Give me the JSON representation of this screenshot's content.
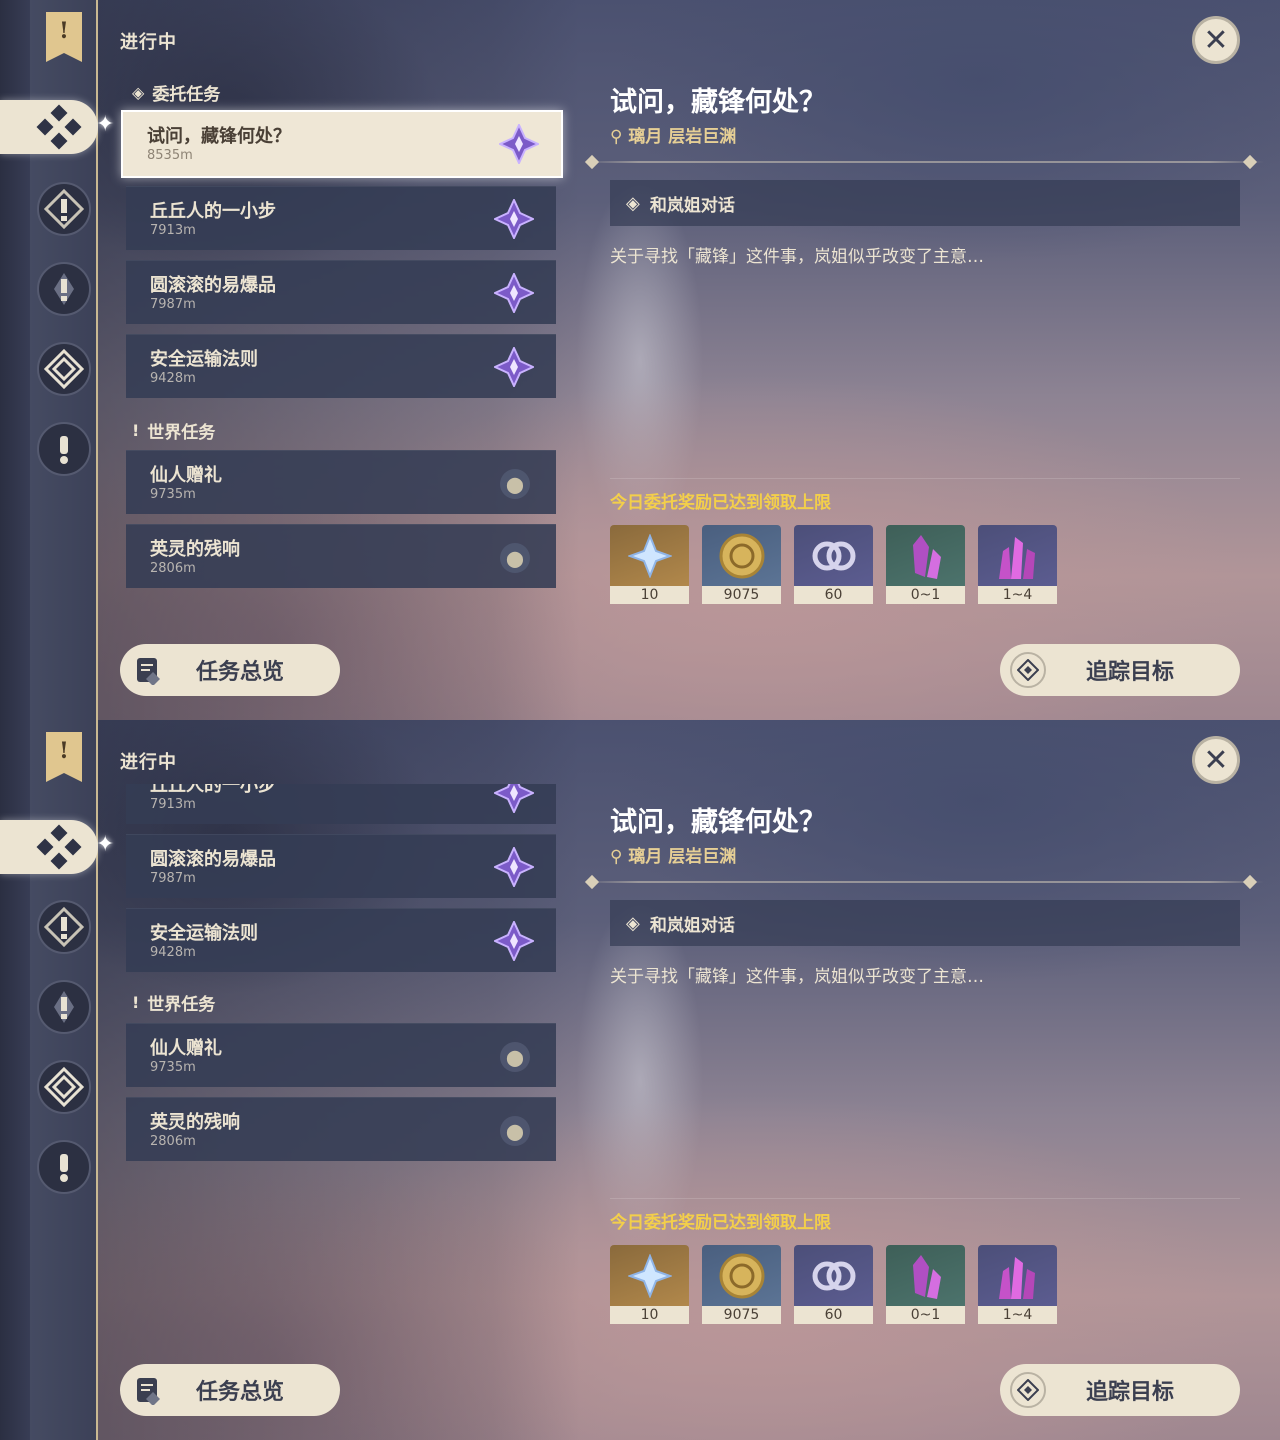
{
  "header": {
    "section_title": "进行中"
  },
  "categories": {
    "commission": "委托任务",
    "world": "世界任务"
  },
  "quests": [
    {
      "name": "试问，藏锋何处？",
      "distance": "8535m",
      "type": "commission"
    },
    {
      "name": "丘丘人的一小步",
      "distance": "7913m",
      "type": "commission"
    },
    {
      "name": "圆滚滚的易爆品",
      "distance": "7987m",
      "type": "commission"
    },
    {
      "name": "安全运输法则",
      "distance": "9428m",
      "type": "commission"
    },
    {
      "name": "仙人赠礼",
      "distance": "9735m",
      "type": "world"
    },
    {
      "name": "英灵的残响",
      "distance": "2806m",
      "type": "world"
    }
  ],
  "detail": {
    "title": "试问，藏锋何处？",
    "location": "璃月 层岩巨渊",
    "objective": "和岚姐对话",
    "description": "关于寻找「藏锋」这件事，岚姐似乎改变了主意…",
    "reward_note": "今日委托奖励已达到领取上限",
    "rewards": [
      {
        "icon": "primogem-icon",
        "qty": "10"
      },
      {
        "icon": "mora-icon",
        "qty": "9075"
      },
      {
        "icon": "companionship-exp-icon",
        "qty": "60"
      },
      {
        "icon": "ore-crystal-icon",
        "qty": "0~1"
      },
      {
        "icon": "crystal-cluster-icon",
        "qty": "1~4"
      }
    ]
  },
  "buttons": {
    "overview": "任务总览",
    "track": "追踪目标"
  },
  "colors": {
    "accent_cream": "#ece4d2",
    "gold_text": "#f3cf4a",
    "location_text": "#e6cf95",
    "panel_dark": "#343c54"
  }
}
